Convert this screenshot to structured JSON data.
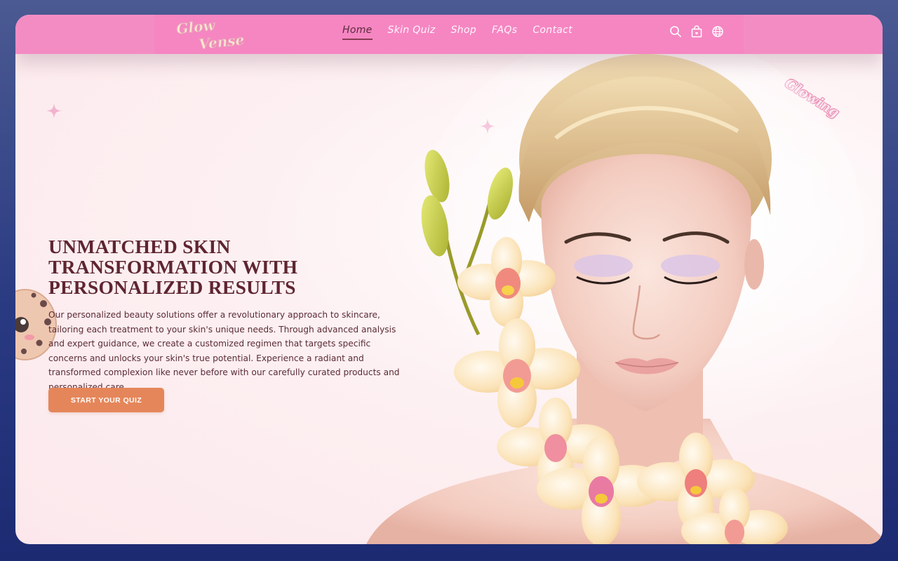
{
  "header": {
    "logo_text": "Glow Vense",
    "nav": [
      {
        "label": "Home",
        "active": true
      },
      {
        "label": "Skin Quiz",
        "active": false
      },
      {
        "label": "Shop",
        "active": false
      },
      {
        "label": "FAQs",
        "active": false
      },
      {
        "label": "Contact",
        "active": false
      }
    ],
    "icons": [
      "search-icon",
      "shopping-bag-icon",
      "globe-icon"
    ]
  },
  "hero": {
    "sticker_text": "Glowing",
    "title_lines": [
      "UNMATCHED SKIN",
      "TRANSFORMATION WITH",
      "PERSONALIZED RESULTS"
    ],
    "description": "Our personalized beauty solutions offer a revolutionary approach to skincare, tailoring each treatment to your skin's unique needs. Through advanced analysis and expert guidance, we create a customized regimen that targets specific concerns and unlocks your skin's true potential. Experience a radiant and transformed complexion like never before with our carefully curated products and personalized care.",
    "cta_label": "START YOUR QUIZ"
  },
  "colors": {
    "header_pink": "#f586c2",
    "title_maroon": "#5e2530",
    "cta_orange": "#e5865a",
    "page_bg": "#fdf0f2",
    "outer_bg": "#2a3a82"
  }
}
